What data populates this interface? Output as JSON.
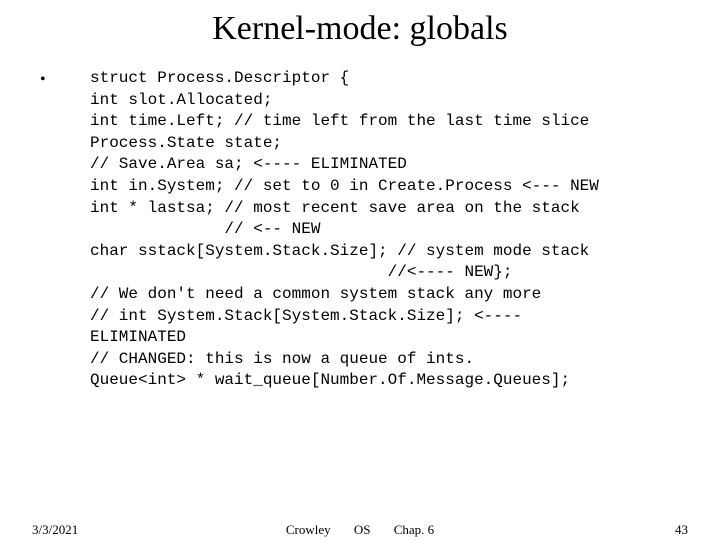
{
  "title": "Kernel-mode: globals",
  "bullet": "•",
  "code": "struct Process.Descriptor {\nint slot.Allocated;\nint time.Left; // time left from the last time slice\nProcess.State state;\n// Save.Area sa; <---- ELIMINATED\nint in.System; // set to 0 in Create.Process <--- NEW\nint * lastsa; // most recent save area on the stack\n              // <-- NEW\nchar sstack[System.Stack.Size]; // system mode stack\n                               //<---- NEW};\n// We don't need a common system stack any more\n// int System.Stack[System.Stack.Size]; <----\nELIMINATED\n// CHANGED: this is now a queue of ints.\nQueue<int> * wait_queue[Number.Of.Message.Queues];",
  "footer": {
    "date": "3/3/2021",
    "author": "Crowley",
    "course": "OS",
    "chapter": "Chap. 6",
    "page": "43"
  }
}
